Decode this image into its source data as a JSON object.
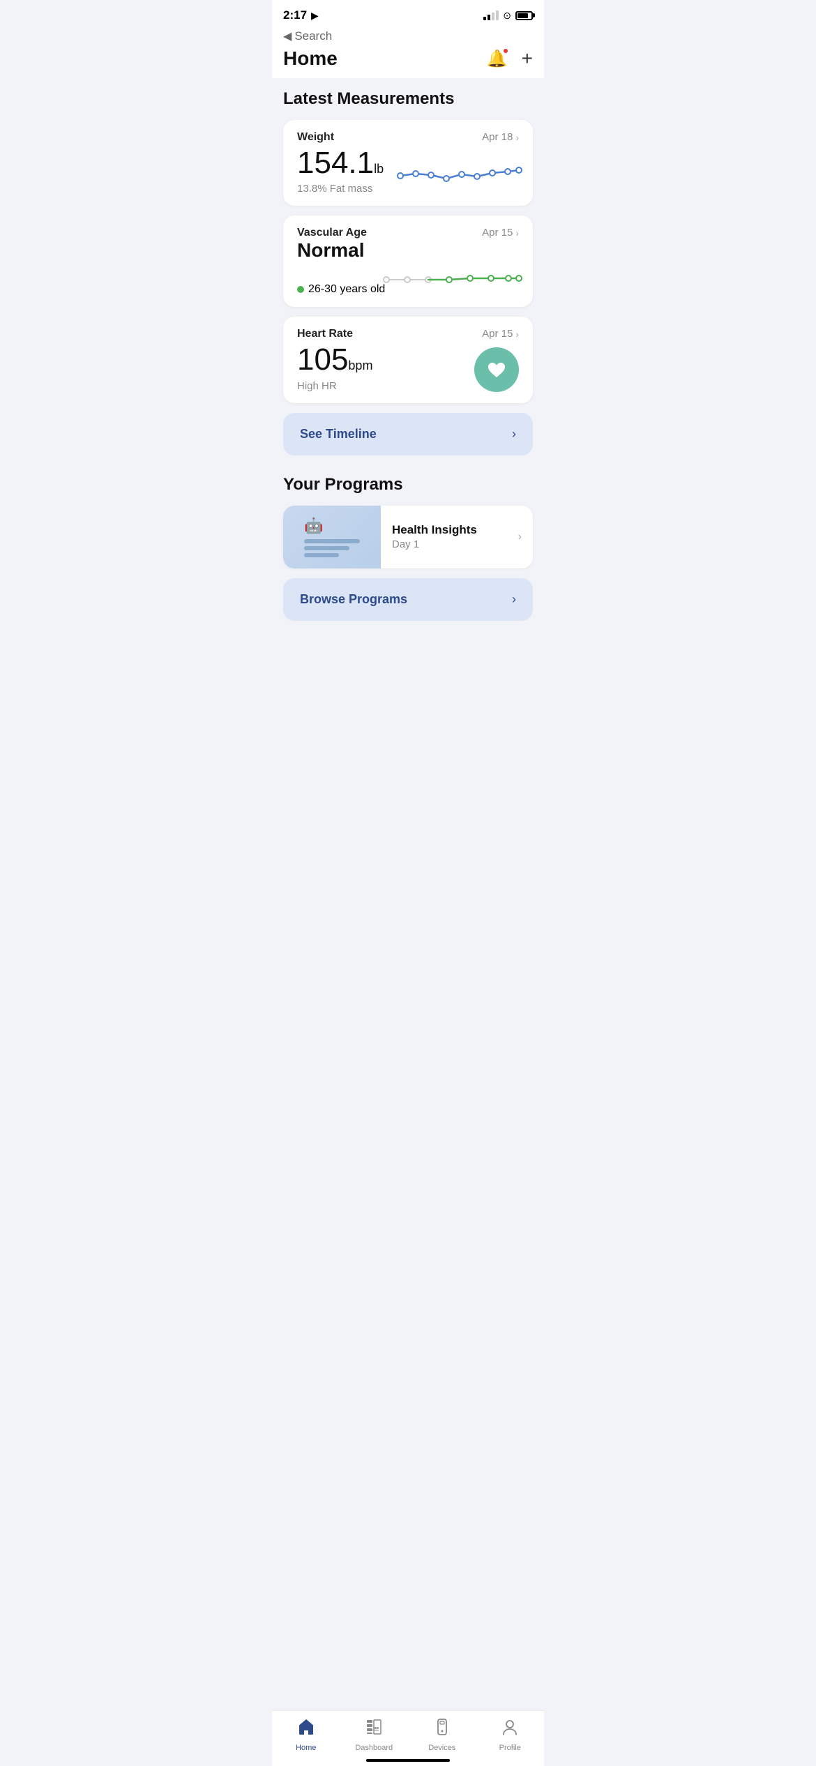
{
  "statusBar": {
    "time": "2:17",
    "navigation_icon": "◀",
    "back_label": "Search"
  },
  "header": {
    "title": "Home",
    "notification_label": "Notifications",
    "add_label": "Add"
  },
  "sections": {
    "measurements": {
      "title": "Latest Measurements",
      "cards": [
        {
          "id": "weight",
          "label": "Weight",
          "date": "Apr 18",
          "value": "154.1",
          "unit": "lb",
          "subtitle": "13.8% Fat mass",
          "chart_type": "line_blue"
        },
        {
          "id": "vascular_age",
          "label": "Vascular Age",
          "status": "Normal",
          "date": "Apr 15",
          "age_range": "26-30 years old",
          "chart_type": "line_green"
        },
        {
          "id": "heart_rate",
          "label": "Heart Rate",
          "date": "Apr 15",
          "value": "105",
          "unit": "bpm",
          "subtitle": "High HR",
          "chart_type": "heart_circle"
        }
      ]
    },
    "timeline": {
      "button_label": "See Timeline",
      "chevron": "›"
    },
    "programs": {
      "title": "Your Programs",
      "items": [
        {
          "name": "Health Insights",
          "day": "Day 1"
        }
      ],
      "browse_label": "Browse Programs"
    }
  },
  "tabBar": {
    "tabs": [
      {
        "id": "home",
        "label": "Home",
        "active": true
      },
      {
        "id": "dashboard",
        "label": "Dashboard",
        "active": false
      },
      {
        "id": "devices",
        "label": "Devices",
        "active": false
      },
      {
        "id": "profile",
        "label": "Profile",
        "active": false
      }
    ]
  }
}
